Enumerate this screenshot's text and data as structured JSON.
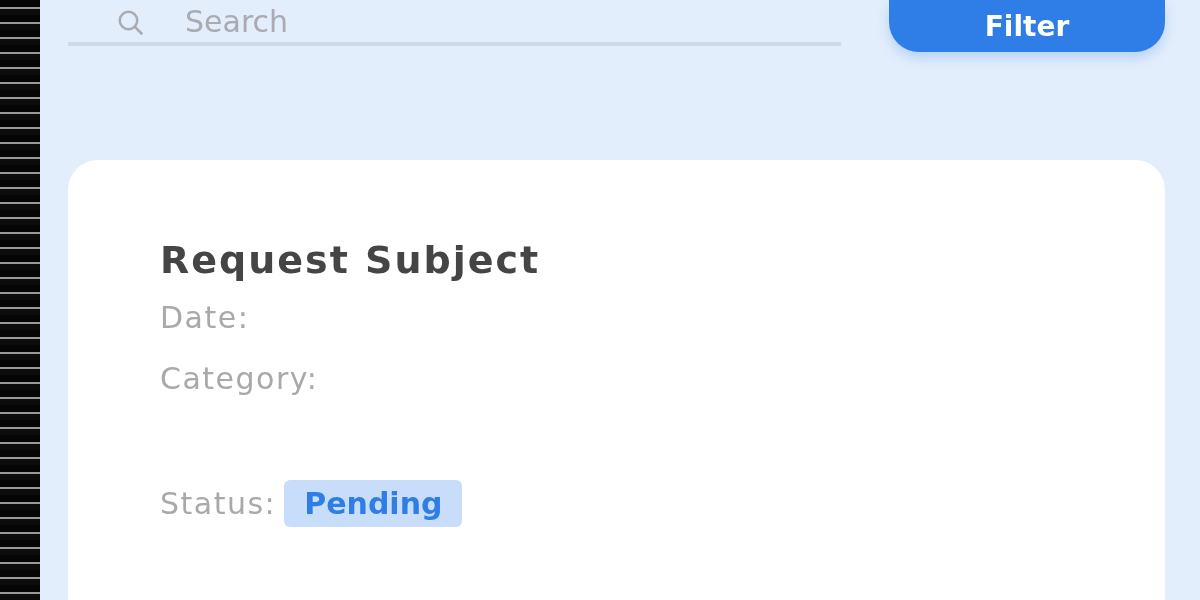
{
  "search": {
    "placeholder": "Search"
  },
  "filter_button": "Filter",
  "card": {
    "title": "Request Subject",
    "fields": [
      {
        "label": "Date:"
      },
      {
        "label": "Category:"
      }
    ],
    "status": {
      "label": "Status:",
      "value": "Pending"
    }
  }
}
